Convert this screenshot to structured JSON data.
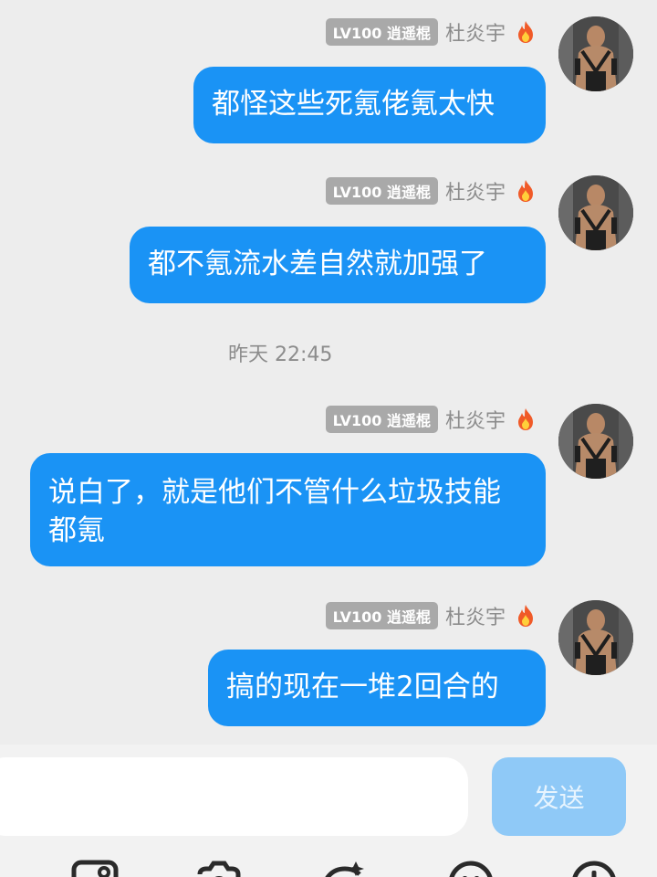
{
  "messages": [
    {
      "level_badge": "LV100 逍遥棍",
      "sender": "杜炎宇",
      "text": "都怪这些死氪佬氪太快"
    },
    {
      "level_badge": "LV100 逍遥棍",
      "sender": "杜炎宇",
      "text": "都不氪流水差自然就加强了"
    },
    {
      "level_badge": "LV100 逍遥棍",
      "sender": "杜炎宇",
      "text": "说白了，就是他们不管什么垃圾技能都氪"
    },
    {
      "level_badge": "LV100 逍遥棍",
      "sender": "杜炎宇",
      "text": "搞的现在一堆2回合的"
    }
  ],
  "timestamp": "昨天 22:45",
  "input": {
    "value": "",
    "placeholder": ""
  },
  "send_label": "发送",
  "toolbar_icons": [
    "image-icon",
    "camera-icon",
    "sticker-icon",
    "emoji-icon",
    "plus-icon"
  ],
  "colors": {
    "bubble": "#1a93f5",
    "send_button": "#8fc9f7",
    "badge": "#a9a9a9"
  }
}
